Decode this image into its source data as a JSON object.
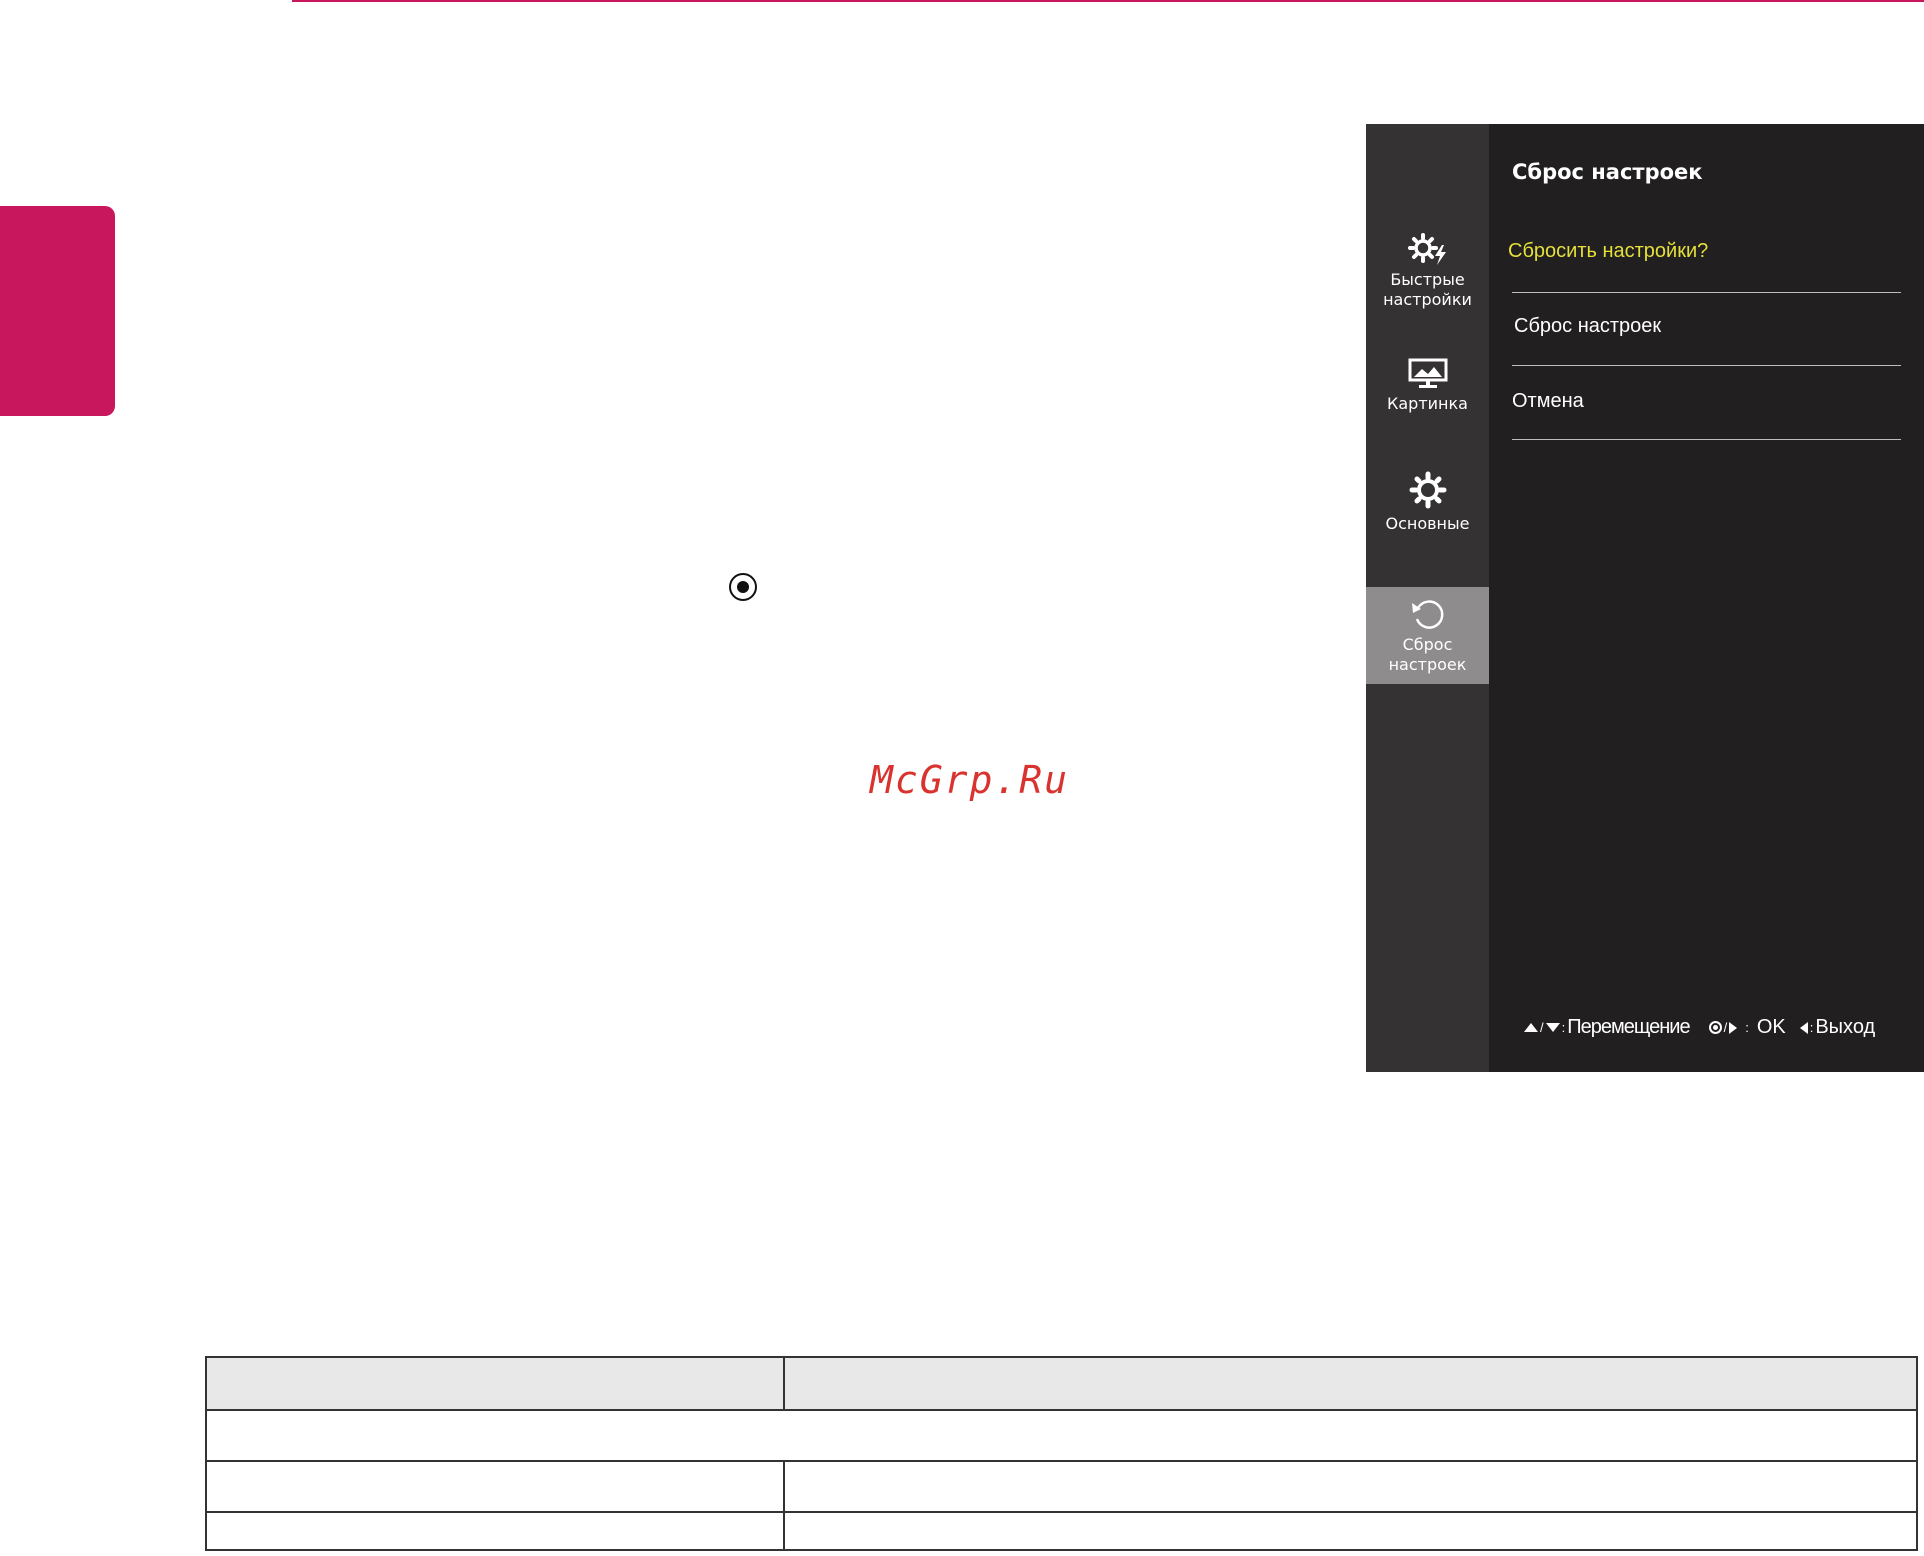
{
  "osd": {
    "nav": {
      "quick_label": "Быстрые настройки",
      "picture_label": "Картинка",
      "general_label": "Основные",
      "reset_label": "Сброс настроек"
    },
    "panel": {
      "title": "Сброс настроек",
      "question": "Сбросить настройки?",
      "options": [
        "Сброс настроек",
        "Отмена"
      ]
    },
    "hints": {
      "move": "Перемещение",
      "ok": "OK",
      "exit": "Выход",
      "sep": "/",
      "colon": ":"
    }
  },
  "watermark": "McGrp.Ru",
  "colors": {
    "accent": "#c8175d",
    "osd_nav_bg": "#353233",
    "osd_panel_bg": "#221f20",
    "osd_selected": "#8e8c8d",
    "question": "#e5df3a"
  }
}
